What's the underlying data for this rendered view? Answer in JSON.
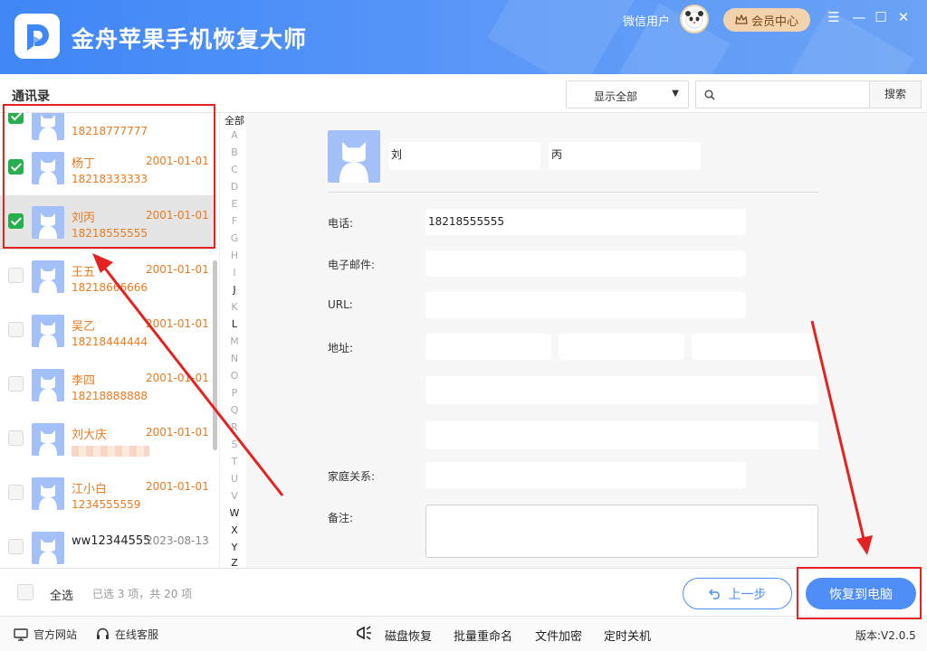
{
  "app": {
    "title": "金舟苹果手机恢复大师",
    "user_name": "微信用户",
    "vip_label": "会员中心",
    "brand_color": "#3f86f7"
  },
  "window_controls": {
    "menu": "☰",
    "minimize": "—",
    "maximize": "☐",
    "close": "✕"
  },
  "toolbar": {
    "section_title": "通讯录",
    "filter_value": "显示全部",
    "search_placeholder": "",
    "search_button": "搜索"
  },
  "contacts": [
    {
      "name": "",
      "phone": "18218777777",
      "date": "",
      "checked": true,
      "selected": false
    },
    {
      "name": "杨丁",
      "phone": "18218333333",
      "date": "2001-01-01",
      "checked": true,
      "selected": false
    },
    {
      "name": "刘丙",
      "phone": "18218555555",
      "date": "2001-01-01",
      "checked": true,
      "selected": true
    },
    {
      "name": "王五",
      "phone": "18218666666",
      "date": "2001-01-01",
      "checked": false,
      "selected": false
    },
    {
      "name": "吴乙",
      "phone": "18218444444",
      "date": "2001-01-01",
      "checked": false,
      "selected": false
    },
    {
      "name": "李四",
      "phone": "18218888888",
      "date": "2001-01-01",
      "checked": false,
      "selected": false
    },
    {
      "name": "刘大庆",
      "phone": "",
      "date": "2001-01-01",
      "checked": false,
      "selected": false
    },
    {
      "name": "江小白",
      "phone": "1234555559",
      "date": "2001-01-01",
      "checked": false,
      "selected": false
    },
    {
      "name": "ww12344555",
      "phone": "",
      "date": "2023-08-13",
      "checked": false,
      "selected": false
    }
  ],
  "alphabet": [
    "全部",
    "A",
    "B",
    "C",
    "D",
    "E",
    "F",
    "G",
    "H",
    "I",
    "J",
    "K",
    "L",
    "M",
    "N",
    "O",
    "P",
    "Q",
    "R",
    "S",
    "T",
    "U",
    "V",
    "W",
    "X",
    "Y",
    "Z"
  ],
  "alphabet_active": [
    "全部",
    "J",
    "L",
    "W",
    "X",
    "Y",
    "Z"
  ],
  "detail": {
    "last_name": "刘",
    "first_name": "丙",
    "labels": {
      "phone": "电话:",
      "email": "电子邮件:",
      "url": "URL:",
      "address": "地址:",
      "family": "家庭关系:",
      "note": "备注:"
    },
    "phone": "18218555555",
    "email": "",
    "url": "",
    "address": [
      "",
      "",
      "",
      "",
      ""
    ],
    "family": "",
    "note": ""
  },
  "bottom": {
    "select_all": "全选",
    "selection_count": "已选 3 项，共 20 项",
    "prev_button": "上一步",
    "restore_button": "恢复到电脑"
  },
  "footer": {
    "official_site": "官方网站",
    "online_service": "在线客服",
    "tools": [
      "磁盘恢复",
      "批量重命名",
      "文件加密",
      "定时关机"
    ],
    "version": "版本:V2.0.5"
  }
}
